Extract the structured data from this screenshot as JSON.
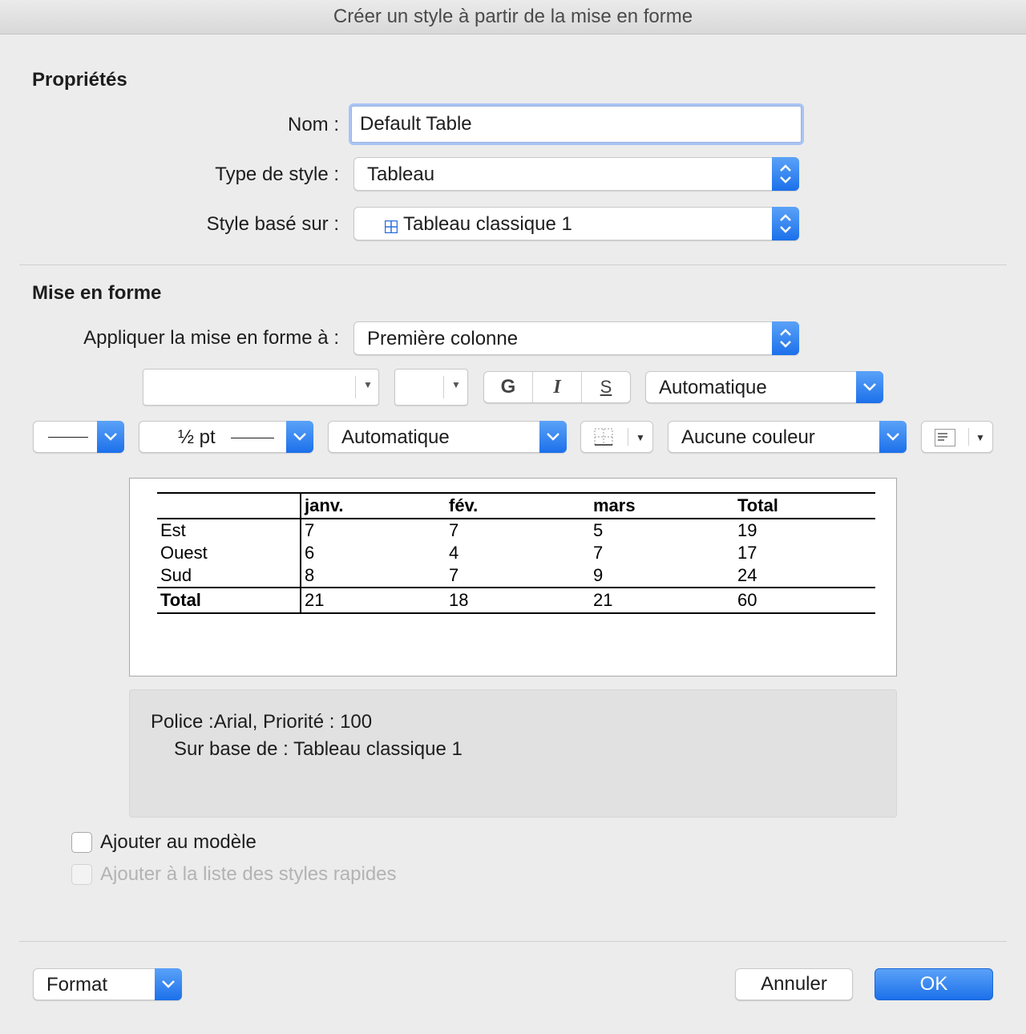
{
  "window": {
    "title": "Créer un style à partir de la mise en forme"
  },
  "properties": {
    "section_title": "Propriétés",
    "name_label": "Nom :",
    "name_value": "Default Table",
    "type_label": "Type de style :",
    "type_value": "Tableau",
    "based_label": "Style basé sur :",
    "based_value": "Tableau classique 1",
    "based_icon": "table-icon"
  },
  "formatting": {
    "section_title": "Mise en forme",
    "apply_label": "Appliquer la mise en forme à :",
    "apply_value": "Première colonne",
    "font_name": "",
    "font_size": "",
    "bold_label": "G",
    "italic_label": "I",
    "strike_label": "S",
    "font_color": "Automatique",
    "line_weight": "½ pt",
    "border_color": "Automatique",
    "shading": "Aucune couleur"
  },
  "preview_table": {
    "headers": [
      "",
      "janv.",
      "fév.",
      "mars",
      "Total"
    ],
    "rows": [
      [
        "Est",
        "7",
        "7",
        "5",
        "19"
      ],
      [
        "Ouest",
        "6",
        "4",
        "7",
        "17"
      ],
      [
        "Sud",
        "8",
        "7",
        "9",
        "24"
      ]
    ],
    "total_row": [
      "Total",
      "21",
      "18",
      "21",
      "60"
    ]
  },
  "description": {
    "line1": "Police :Arial, Priorité : 100",
    "line2": "Sur base de : Tableau classique 1"
  },
  "options": {
    "add_to_template": "Ajouter au modèle",
    "add_to_template_checked": false,
    "add_to_quick_styles": "Ajouter à la liste des styles rapides",
    "add_to_quick_styles_enabled": false
  },
  "footer": {
    "format_label": "Format",
    "cancel_label": "Annuler",
    "ok_label": "OK"
  },
  "colors": {
    "accent": "#1c70ea",
    "focus_ring": "#a9c4f5",
    "window_bg": "#ececec"
  }
}
